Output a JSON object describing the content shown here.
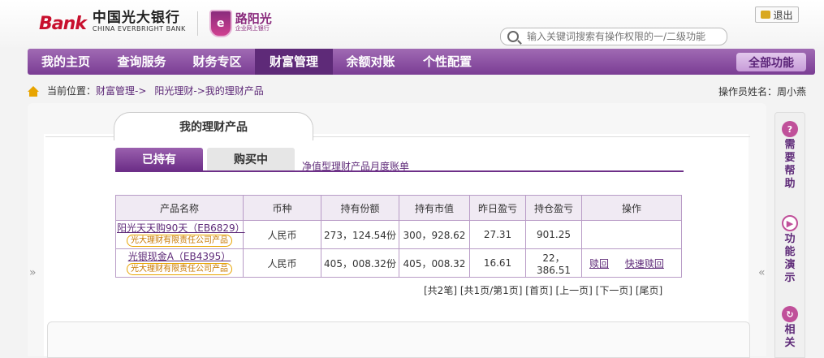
{
  "header": {
    "brand_mark": "Bank",
    "brand_cn": "中国光大银行",
    "brand_en": "CHINA EVERBRIGHT BANK",
    "sub_brand": "路阳光",
    "sub_brand_small": "企业网上银行",
    "logout_label": "退出",
    "search_placeholder": "输入关键词搜索有操作权限的一/二级功能"
  },
  "nav": {
    "items": [
      "我的主页",
      "查询服务",
      "财务专区",
      "财富管理",
      "余额对账",
      "个性配置"
    ],
    "active_index": 3,
    "all_functions": "全部功能"
  },
  "breadcrumb": {
    "prefix": "当前位置：",
    "path1": "财富管理->",
    "path2": "阳光理财->我的理财产品",
    "operator": "操作员姓名：周小燕"
  },
  "page_title": "我的理财产品",
  "tabs": {
    "held": "已持有",
    "buying": "购买中",
    "monthly_link": "净值型理财产品月度账单"
  },
  "table": {
    "headers": [
      "产品名称",
      "币种",
      "持有份额",
      "持有市值",
      "昨日盈亏",
      "持仓盈亏",
      "操作"
    ],
    "rows": [
      {
        "name": "阳光天天购90天（EB6829）",
        "issuer": "光大理财有限责任公司产品",
        "currency": "人民币",
        "shares": "273，124.54份",
        "market_value": "300，928.62",
        "yesterday_pl": "27.31",
        "position_pl": "901.25",
        "ops": []
      },
      {
        "name": "光银现金A（EB4395）",
        "issuer": "光大理财有限责任公司产品",
        "currency": "人民币",
        "shares": "405，008.32份",
        "market_value": "405，008.32",
        "yesterday_pl": "16.61",
        "position_pl": "22，386.51",
        "ops": [
          "赎回",
          "快速赎回"
        ]
      }
    ]
  },
  "pager": "[共2笔] [共1页/第1页] [首页] [上一页] [下一页] [尾页]",
  "sidebar": {
    "help": "需要帮助",
    "demo": "功能演示",
    "related": "相关"
  },
  "arrows": {
    "left": "»",
    "right": "«"
  },
  "colors": {
    "brand_purple": "#7a3d94",
    "brand_red": "#c8102e",
    "accent_orange": "#e8a400"
  }
}
